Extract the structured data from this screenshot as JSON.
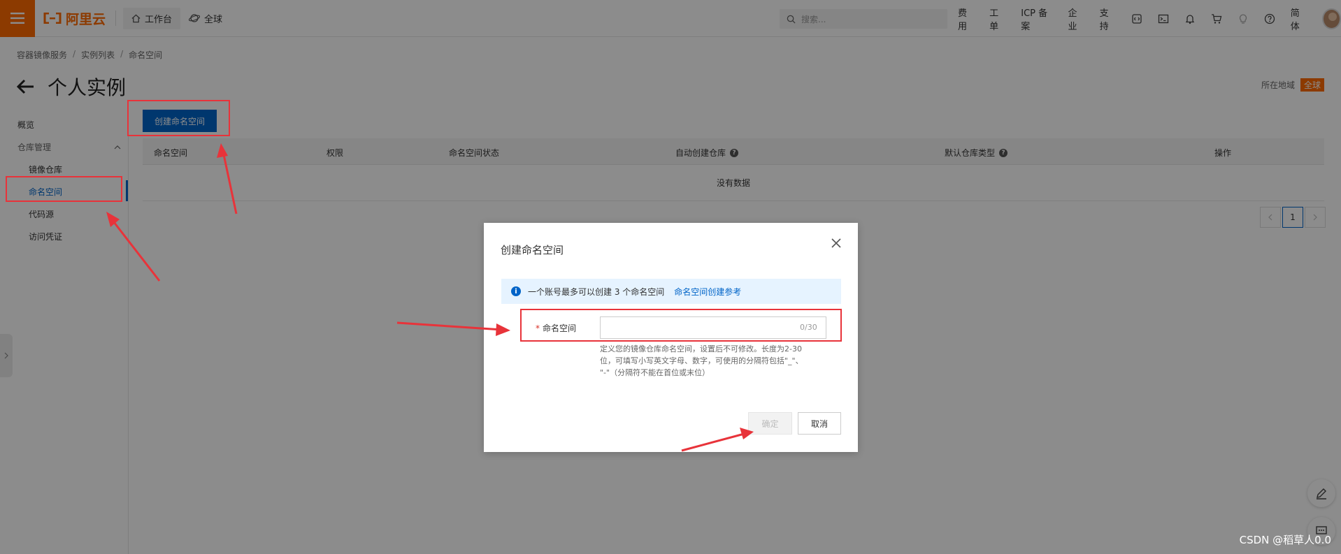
{
  "topbar": {
    "logo_text": "阿里云",
    "workbench_label": "工作台",
    "global_label": "全球",
    "search_placeholder": "搜索...",
    "links": [
      "费用",
      "工单",
      "ICP 备案",
      "企业",
      "支持"
    ],
    "lang_label": "简体"
  },
  "breadcrumb": [
    "容器镜像服务",
    "实例列表",
    "命名空间"
  ],
  "page": {
    "title": "个人实例",
    "region_label": "所在地域",
    "region_value": "全球"
  },
  "sidebar": {
    "overview": "概览",
    "repo_mgmt": "仓库管理",
    "items": [
      "镜像仓库",
      "命名空间",
      "代码源",
      "访问凭证"
    ]
  },
  "main": {
    "create_button": "创建命名空间",
    "columns": [
      "命名空间",
      "权限",
      "命名空间状态",
      "自动创建仓库",
      "默认仓库类型",
      "操作"
    ],
    "empty_text": "没有数据",
    "page_current": "1"
  },
  "modal": {
    "title": "创建命名空间",
    "notice_text": "一个账号最多可以创建 3 个命名空间",
    "notice_link": "命名空间创建参考",
    "field_required": "*",
    "field_label": "命名空间",
    "field_value": "",
    "field_count": "0/30",
    "help_line1": "定义您的镜像仓库命名空间，设置后不可修改。长度为2-30",
    "help_line2": "位，可填写小写英文字母、数字，可使用的分隔符包括\"_\"、",
    "help_line3": "\"-\"（分隔符不能在首位或末位）",
    "ok_label": "确定",
    "cancel_label": "取消"
  },
  "watermark": "CSDN @稻草人0.0",
  "colors": {
    "brand": "#ff6a00",
    "primary": "#0064c8",
    "annotation": "#e8333a"
  }
}
